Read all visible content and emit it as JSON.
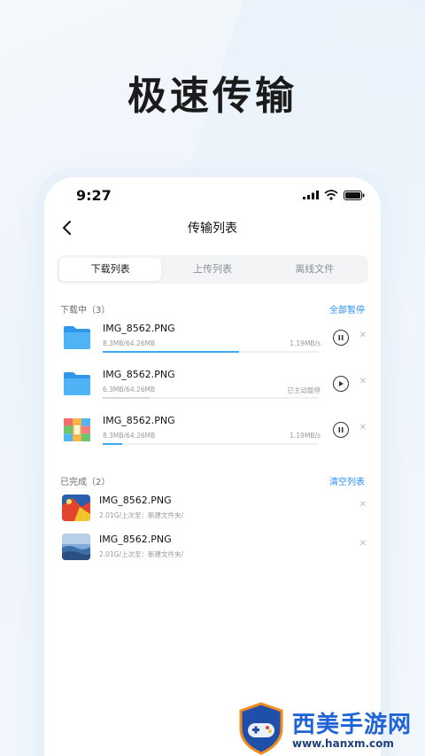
{
  "headline": "极速传输",
  "status": {
    "time": "9:27"
  },
  "nav": {
    "title": "传输列表"
  },
  "tabs": [
    {
      "label": "下载列表",
      "active": true
    },
    {
      "label": "上传列表",
      "active": false
    },
    {
      "label": "离线文件",
      "active": false
    }
  ],
  "downloading": {
    "label": "下载中（3）",
    "action": "全部暂停",
    "items": [
      {
        "name": "IMG_8562.PNG",
        "meta": "8.3MB/64.26MB",
        "speed": "1.19MB/s",
        "progress": 0.63,
        "state": "pause"
      },
      {
        "name": "IMG_8562.PNG",
        "meta": "6.3MB/64.26MB",
        "speed": "已主动暂停",
        "progress": 0.22,
        "state": "play"
      },
      {
        "name": "IMG_8562.PNG",
        "meta": "8.3MB/64.26MB",
        "speed": "1.19MB/s",
        "progress": 0.09,
        "state": "pause"
      }
    ]
  },
  "completed": {
    "label": "已完成（2）",
    "action": "清空列表",
    "items": [
      {
        "name": "IMG_8562.PNG",
        "meta": "2.01G/上次至：新建文件夹/"
      },
      {
        "name": "IMG_8562.PNG",
        "meta": "2.01G/上次至：新建文件夹/"
      }
    ]
  },
  "watermark": {
    "cn": "西美手游网",
    "url": "www.hanxm.com"
  },
  "colors": {
    "accent": "#2b8ef0",
    "progress": "#3fa8f4",
    "folder": "#3aa3ef"
  }
}
